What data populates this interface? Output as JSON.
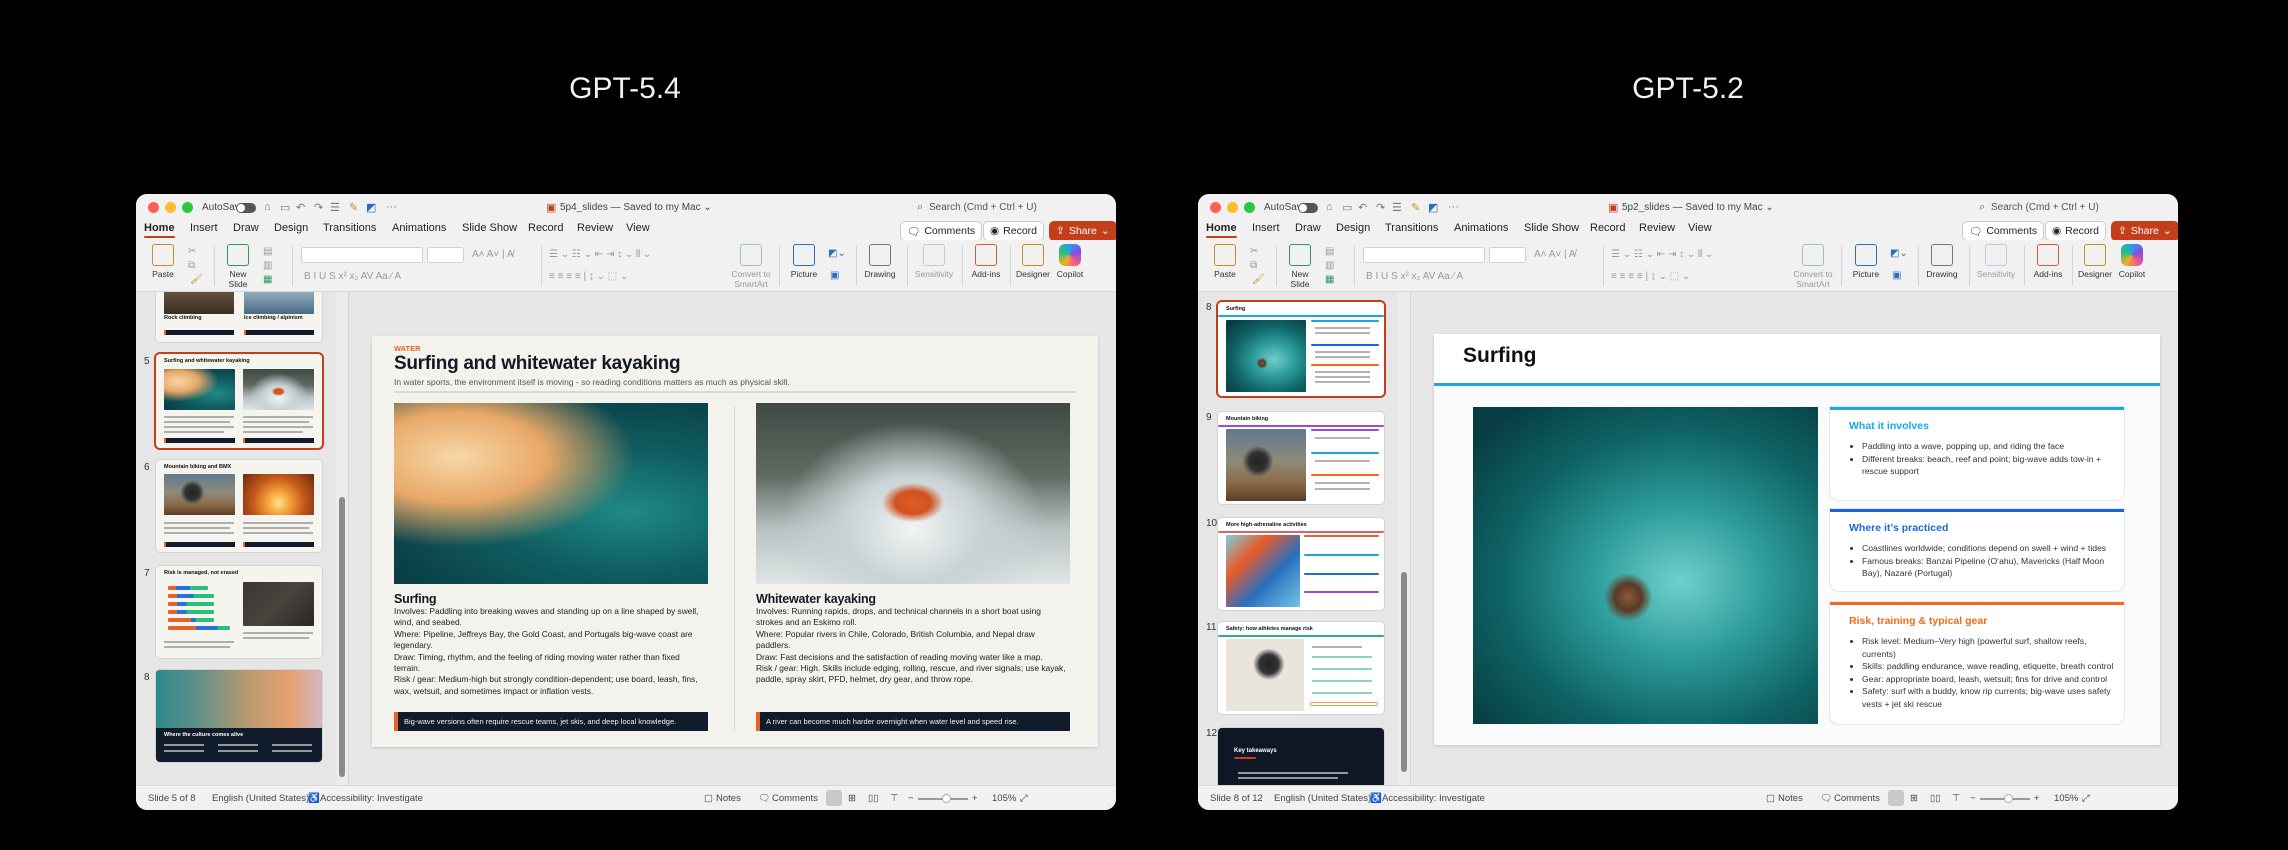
{
  "labels": {
    "left": "GPT-5.4",
    "right": "GPT-5.2"
  },
  "colors": {
    "accent": "#c43e1c",
    "orange": "#e8632a",
    "navy": "#101b2b",
    "blue": "#1aa7e0",
    "blue2": "#1a66e0"
  },
  "windows": [
    {
      "file_title": "5p4_slides — Saved to my Mac ⌄",
      "autosave": "AutoSave",
      "search": "Search (Cmd + Ctrl + U)",
      "tabs": [
        "Home",
        "Insert",
        "Draw",
        "Design",
        "Transitions",
        "Animations",
        "Slide Show",
        "Record",
        "Review",
        "View"
      ],
      "comments": "Comments",
      "record": "Record",
      "share": "Share",
      "ribbon": {
        "paste": "Paste",
        "new_slide": "New Slide",
        "smartart": "Convert to SmartArt",
        "picture": "Picture",
        "drawing": "Drawing",
        "sensitivity": "Sensitivity",
        "addins": "Add-ins",
        "designer": "Designer",
        "copilot": "Copilot"
      },
      "status": {
        "slide": "Slide 5 of 8",
        "language": "English (United States)",
        "accessibility": "Accessibility: Investigate",
        "notes": "Notes",
        "comments": "Comments",
        "zoom": "105%"
      },
      "zoom_fraction": 0.55
    },
    {
      "file_title": "5p2_slides — Saved to my Mac ⌄",
      "autosave": "AutoSave",
      "search": "Search (Cmd + Ctrl + U)",
      "tabs": [
        "Home",
        "Insert",
        "Draw",
        "Design",
        "Transitions",
        "Animations",
        "Slide Show",
        "Record",
        "Review",
        "View"
      ],
      "comments": "Comments",
      "record": "Record",
      "share": "Share",
      "ribbon": {
        "paste": "Paste",
        "new_slide": "New Slide",
        "smartart": "Convert to SmartArt",
        "picture": "Picture",
        "drawing": "Drawing",
        "sensitivity": "Sensitivity",
        "addins": "Add-ins",
        "designer": "Designer",
        "copilot": "Copilot"
      },
      "status": {
        "slide": "Slide 8 of 12",
        "language": "English (United States)",
        "accessibility": "Accessibility: Investigate",
        "notes": "Notes",
        "comments": "Comments",
        "zoom": "105%"
      },
      "zoom_fraction": 0.55
    }
  ],
  "thumbsA": [
    {
      "num": "",
      "titles": [
        "Rock climbing",
        "Ice climbing / alpinism"
      ]
    },
    {
      "num": "5",
      "title": "Surfing and whitewater kayaking"
    },
    {
      "num": "6",
      "title": "Mountain biking and BMX"
    },
    {
      "num": "7",
      "title": "Risk is managed, not erased"
    },
    {
      "num": "8",
      "title": "Where the culture comes alive"
    }
  ],
  "thumbsB": [
    {
      "num": "8",
      "title": "Surfing"
    },
    {
      "num": "9",
      "title": "Mountain biking"
    },
    {
      "num": "10",
      "title": "More high-adrenaline activities"
    },
    {
      "num": "11",
      "title": "Safety: how athletes manage risk"
    },
    {
      "num": "12",
      "title": "Key takeaways"
    }
  ],
  "slideA": {
    "kicker": "WATER",
    "title": "Surfing and whitewater kayaking",
    "subtitle": "In water sports, the environment itself is moving - so reading conditions matters as much as physical skill.",
    "columns": [
      {
        "heading": "Surfing",
        "lines": [
          "Involves: Paddling into breaking waves and standing up on a line shaped by swell, wind, and seabed.",
          "Where: Pipeline, Jeffreys Bay, the Gold Coast, and Portugals big-wave coast are legendary.",
          "Draw: Timing, rhythm, and the feeling of riding moving water rather than fixed terrain.",
          "Risk / gear: Medium-high but strongly condition-dependent; use board, leash, fins, wax, wetsuit, and sometimes impact or inflation vests."
        ],
        "callout": "Big-wave versions often require rescue teams, jet skis, and deep local knowledge."
      },
      {
        "heading": "Whitewater kayaking",
        "lines": [
          "Involves: Running rapids, drops, and technical channels in a short boat using strokes and an Eskimo roll.",
          "Where: Popular rivers in Chile, Colorado, British Columbia, and Nepal draw paddlers.",
          "Draw: Fast decisions and the satisfaction of reading moving water like a map.",
          "Risk / gear: High. Skills include edging, rolling, rescue, and river signals; use kayak, paddle, spray skirt, PFD, helmet, dry gear, and throw rope."
        ],
        "callout": "A river can become much harder overnight when water level and speed rise."
      }
    ]
  },
  "slideB": {
    "title": "Surfing",
    "cards": [
      {
        "heading": "What it involves",
        "color": "#1aa7e0",
        "bullets": [
          "Paddling into a wave, popping up, and riding the face",
          "Different breaks: beach, reef and point; big-wave adds tow-in + rescue support"
        ]
      },
      {
        "heading": "Where it’s practiced",
        "color": "#1a66e0",
        "bullets": [
          "Coastlines worldwide; conditions depend on swell + wind + tides",
          "Famous breaks: Banzai Pipeline (O‘ahu), Mavericks (Half Moon Bay), Nazaré (Portugal)"
        ]
      },
      {
        "heading": "Risk, training & typical gear",
        "color": "#f26a1b",
        "bullets": [
          "Risk level: Medium–Very high (powerful surf, shallow reefs, currents)",
          "Skills: paddling endurance, wave reading, etiquette, breath control",
          "Gear: appropriate board, leash, wetsuit; fins for drive and control",
          "Safety: surf with a buddy, know rip currents; big-wave uses safety vests + jet ski rescue"
        ]
      }
    ]
  }
}
